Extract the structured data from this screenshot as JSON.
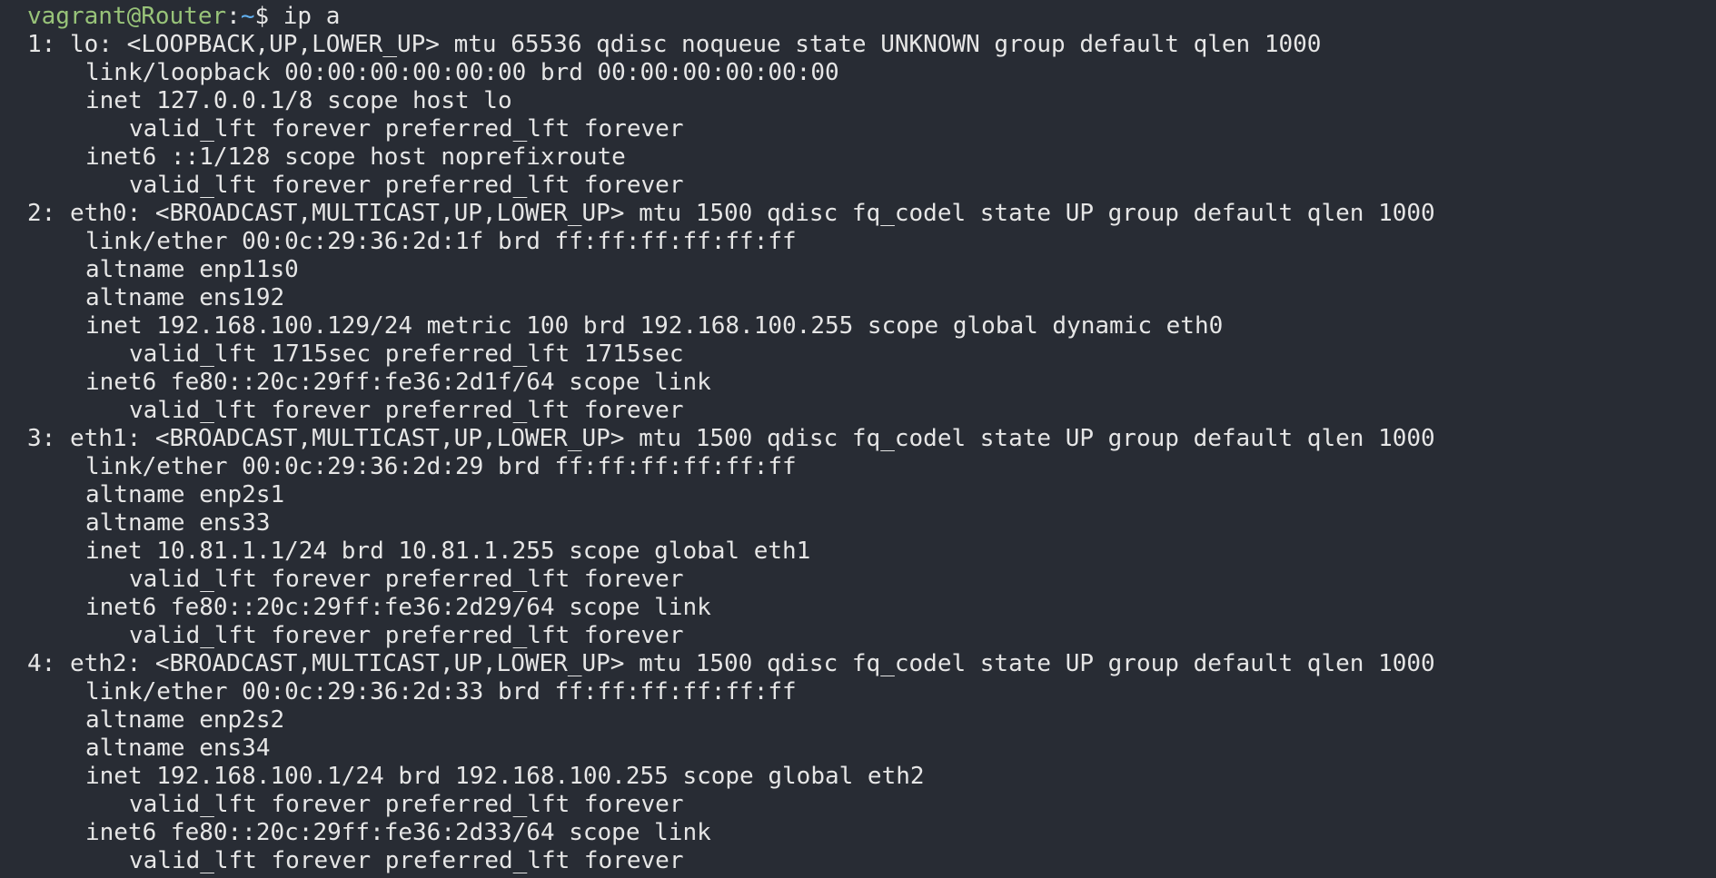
{
  "prompt": {
    "user_host": "vagrant@Router",
    "colon": ":",
    "cwd": "~",
    "dollar": "$ ",
    "command": "ip a"
  },
  "output": {
    "line_01": "1: lo: <LOOPBACK,UP,LOWER_UP> mtu 65536 qdisc noqueue state UNKNOWN group default qlen 1000",
    "line_02": "link/loopback 00:00:00:00:00:00 brd 00:00:00:00:00:00",
    "line_03": "inet 127.0.0.1/8 scope host lo",
    "line_04": "valid_lft forever preferred_lft forever",
    "line_05": "inet6 ::1/128 scope host noprefixroute",
    "line_06": "valid_lft forever preferred_lft forever",
    "line_07": "2: eth0: <BROADCAST,MULTICAST,UP,LOWER_UP> mtu 1500 qdisc fq_codel state UP group default qlen 1000",
    "line_08": "link/ether 00:0c:29:36:2d:1f brd ff:ff:ff:ff:ff:ff",
    "line_09": "altname enp11s0",
    "line_10": "altname ens192",
    "line_11": "inet 192.168.100.129/24 metric 100 brd 192.168.100.255 scope global dynamic eth0",
    "line_12": "valid_lft 1715sec preferred_lft 1715sec",
    "line_13": "inet6 fe80::20c:29ff:fe36:2d1f/64 scope link",
    "line_14": "valid_lft forever preferred_lft forever",
    "line_15": "3: eth1: <BROADCAST,MULTICAST,UP,LOWER_UP> mtu 1500 qdisc fq_codel state UP group default qlen 1000",
    "line_16": "link/ether 00:0c:29:36:2d:29 brd ff:ff:ff:ff:ff:ff",
    "line_17": "altname enp2s1",
    "line_18": "altname ens33",
    "line_19": "inet 10.81.1.1/24 brd 10.81.1.255 scope global eth1",
    "line_20": "valid_lft forever preferred_lft forever",
    "line_21": "inet6 fe80::20c:29ff:fe36:2d29/64 scope link",
    "line_22": "valid_lft forever preferred_lft forever",
    "line_23": "4: eth2: <BROADCAST,MULTICAST,UP,LOWER_UP> mtu 1500 qdisc fq_codel state UP group default qlen 1000",
    "line_24": "link/ether 00:0c:29:36:2d:33 brd ff:ff:ff:ff:ff:ff",
    "line_25": "altname enp2s2",
    "line_26": "altname ens34",
    "line_27": "inet 192.168.100.1/24 brd 192.168.100.255 scope global eth2",
    "line_28": "valid_lft forever preferred_lft forever",
    "line_29": "inet6 fe80::20c:29ff:fe36:2d33/64 scope link",
    "line_30": "valid_lft forever preferred_lft forever"
  },
  "colors": {
    "background": "#282c34",
    "text": "#e6e6e6",
    "user_host": "#98c379",
    "cwd": "#61afef"
  }
}
